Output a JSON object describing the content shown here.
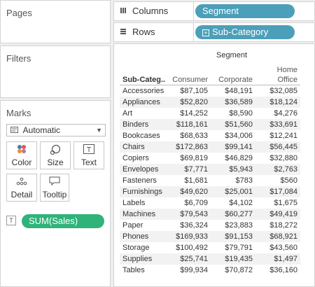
{
  "pages": {
    "title": "Pages"
  },
  "filters": {
    "title": "Filters"
  },
  "marks": {
    "title": "Marks",
    "mark_type": "Automatic",
    "buttons": {
      "color": "Color",
      "size": "Size",
      "text": "Text",
      "detail": "Detail",
      "tooltip": "Tooltip"
    },
    "text_pill": "SUM(Sales)"
  },
  "shelves": {
    "columns_label": "Columns",
    "columns_pill": "Segment",
    "rows_label": "Rows",
    "rows_pill": "Sub-Category"
  },
  "colors": {
    "dimension_pill": "#4c9fb9",
    "measure_pill": "#2fb37a"
  },
  "table": {
    "segment_header": "Segment",
    "columns": {
      "subcategory": "Sub-Categ..",
      "consumer": "Consumer",
      "corporate": "Corporate",
      "home_office_line1": "Home",
      "home_office_line2": "Office"
    },
    "rows": [
      {
        "sub": "Accessories",
        "consumer": "$87,105",
        "corporate": "$48,191",
        "home": "$32,085"
      },
      {
        "sub": "Appliances",
        "consumer": "$52,820",
        "corporate": "$36,589",
        "home": "$18,124"
      },
      {
        "sub": "Art",
        "consumer": "$14,252",
        "corporate": "$8,590",
        "home": "$4,276"
      },
      {
        "sub": "Binders",
        "consumer": "$118,161",
        "corporate": "$51,560",
        "home": "$33,691"
      },
      {
        "sub": "Bookcases",
        "consumer": "$68,633",
        "corporate": "$34,006",
        "home": "$12,241"
      },
      {
        "sub": "Chairs",
        "consumer": "$172,863",
        "corporate": "$99,141",
        "home": "$56,445"
      },
      {
        "sub": "Copiers",
        "consumer": "$69,819",
        "corporate": "$46,829",
        "home": "$32,880"
      },
      {
        "sub": "Envelopes",
        "consumer": "$7,771",
        "corporate": "$5,943",
        "home": "$2,763"
      },
      {
        "sub": "Fasteners",
        "consumer": "$1,681",
        "corporate": "$783",
        "home": "$560"
      },
      {
        "sub": "Furnishings",
        "consumer": "$49,620",
        "corporate": "$25,001",
        "home": "$17,084"
      },
      {
        "sub": "Labels",
        "consumer": "$6,709",
        "corporate": "$4,102",
        "home": "$1,675"
      },
      {
        "sub": "Machines",
        "consumer": "$79,543",
        "corporate": "$60,277",
        "home": "$49,419"
      },
      {
        "sub": "Paper",
        "consumer": "$36,324",
        "corporate": "$23,883",
        "home": "$18,272"
      },
      {
        "sub": "Phones",
        "consumer": "$169,933",
        "corporate": "$91,153",
        "home": "$68,921"
      },
      {
        "sub": "Storage",
        "consumer": "$100,492",
        "corporate": "$79,791",
        "home": "$43,560"
      },
      {
        "sub": "Supplies",
        "consumer": "$25,741",
        "corporate": "$19,435",
        "home": "$1,497"
      },
      {
        "sub": "Tables",
        "consumer": "$99,934",
        "corporate": "$70,872",
        "home": "$36,160"
      }
    ]
  }
}
